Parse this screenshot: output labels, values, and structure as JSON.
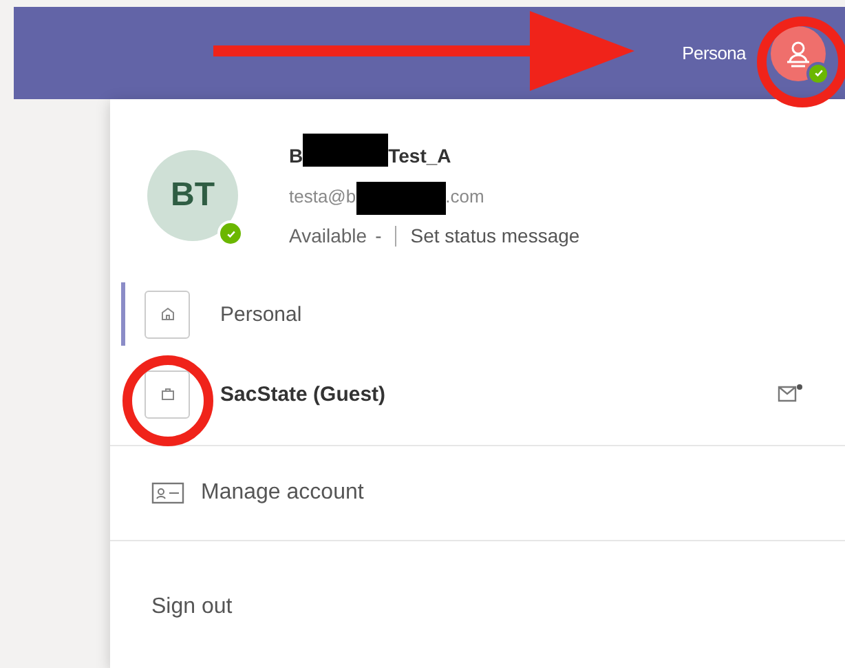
{
  "top_bar": {
    "account_label": "Persona",
    "available": true
  },
  "profile": {
    "initials": "BT",
    "name_start": "B",
    "name_end": "Test_A",
    "email_start": "testa@b",
    "email_end": ".com",
    "redacted": true,
    "available": true,
    "status_label": "Available",
    "separator": "-",
    "status_message_link": "Set status message"
  },
  "accounts": [
    {
      "label": "Personal",
      "selected": true,
      "current": false,
      "mail_badge": false
    },
    {
      "label": "SacState (Guest)",
      "selected": false,
      "current": true,
      "mail_badge": true
    }
  ],
  "actions": [
    {
      "kind": "manage",
      "label": "Manage account"
    },
    {
      "kind": "plain",
      "label": "Sign out"
    }
  ],
  "annotations": [
    {
      "kind": "arrow"
    },
    {
      "kind": "circle"
    },
    {
      "kind": "circle"
    }
  ]
}
